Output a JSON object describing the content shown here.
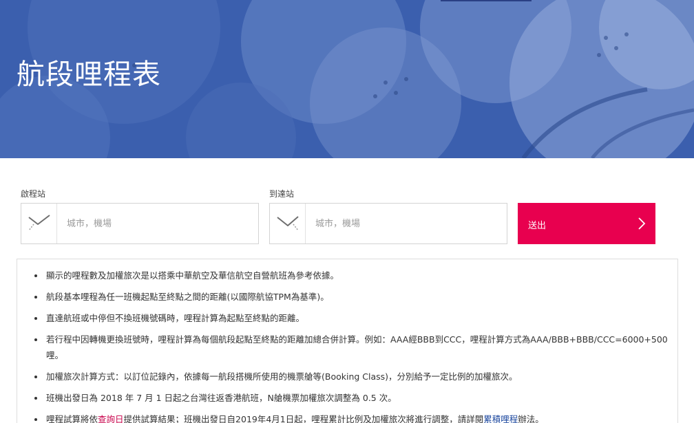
{
  "hero": {
    "title": "航段哩程表"
  },
  "search": {
    "departure": {
      "label": "啟程站",
      "placeholder": "城市，機場"
    },
    "arrival": {
      "label": "到達站",
      "placeholder": "城市，機場"
    },
    "submit_label": "送出"
  },
  "notes": {
    "items": [
      "顯示的哩程數及加權旅次是以搭乘中華航空及華信航空自營航班為參考依據。",
      "航段基本哩程為任一班機起點至終點之間的距離(以國際航協TPM為基準)。",
      "直達航班或中停但不換班機號碼時，哩程計算為起點至終點的距離。",
      "若行程中因轉機更換班號時，哩程計算為每個航段起點至終點的距離加總合併計算。例如：AAA經BBB到CCC，哩程計算方式為AAA/BBB+BBB/CCC=6000+500 哩。",
      "加權旅次計算方式：以訂位記錄內，依據每一航段搭機所使用的機票艙等(Booking Class)，分別給予一定比例的加權旅次。",
      "班機出發日為 2018 年 7 月 1 日起之台灣往返香港航班，N艙機票加權旅次調整為 0.5 次。"
    ],
    "last_item": {
      "prefix": "哩程試算將依",
      "link1": "查詢日",
      "middle": "提供試算結果；班機出發日自2019年4月1日起，哩程累計比例及加權旅次將進行調整，請詳閱",
      "link2": "累積哩程",
      "suffix": "辦法。"
    }
  },
  "colors": {
    "hero_bg": "#3a5fae",
    "accent": "#e8004f",
    "link_blue": "#1f4aa0"
  },
  "icons": {
    "departure": "plane-takeoff-icon",
    "arrival": "plane-landing-icon",
    "submit": "chevron-right-icon"
  }
}
